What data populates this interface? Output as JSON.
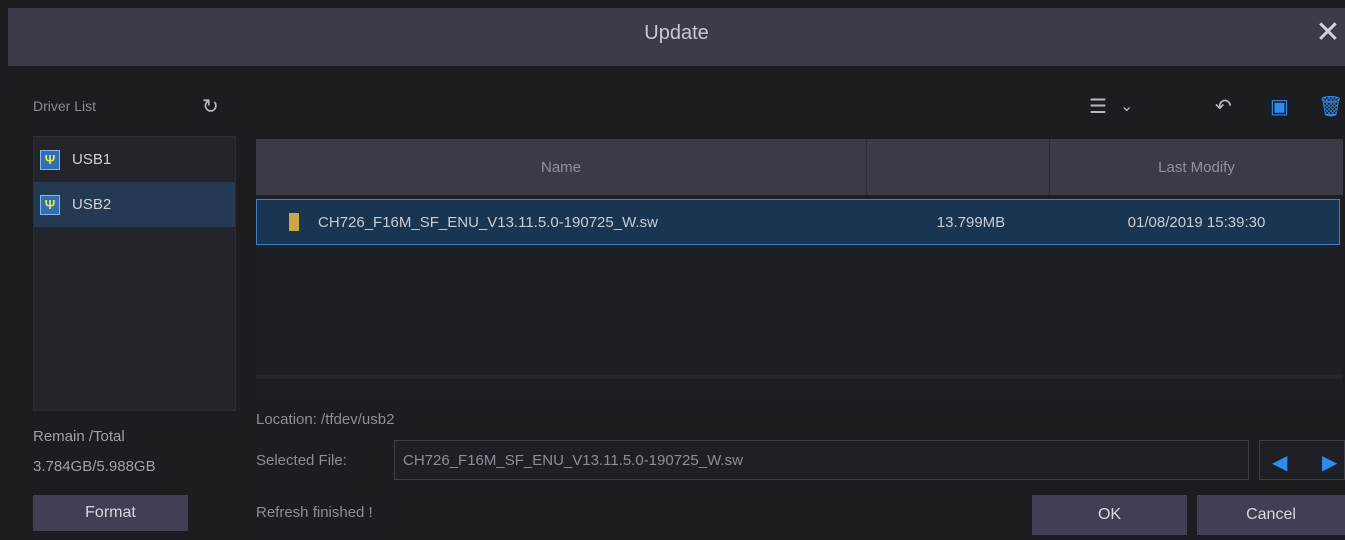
{
  "dialog": {
    "title": "Update",
    "close_icon": "close-icon"
  },
  "left": {
    "header": "Driver List",
    "drives": [
      {
        "label": "USB1",
        "selected": false
      },
      {
        "label": "USB2",
        "selected": true
      }
    ],
    "remain_label": "Remain /Total",
    "remain_value": "3.784GB/5.988GB",
    "format_label": "Format"
  },
  "toolbar": {
    "icons": [
      "list-view-icon",
      "chevron-down-icon",
      "back-icon",
      "copy-icon",
      "delete-icon"
    ]
  },
  "table": {
    "columns": [
      "Name",
      "",
      "Last Modify"
    ],
    "rows": [
      {
        "name": "CH726_F16M_SF_ENU_V13.11.5.0-190725_W.sw",
        "size": "13.799MB",
        "modified": "01/08/2019 15:39:30",
        "selected": true
      }
    ]
  },
  "footer": {
    "location": "Location: /tfdev/usb2",
    "selected_file_label": "Selected File:",
    "selected_file_value": "CH726_F16M_SF_ENU_V13.11.5.0-190725_W.sw",
    "status": "Refresh finished !",
    "ok_label": "OK",
    "cancel_label": "Cancel"
  },
  "colors": {
    "accent": "#2d8cf0",
    "selection": "#1a3551",
    "button": "#3f3f55"
  }
}
